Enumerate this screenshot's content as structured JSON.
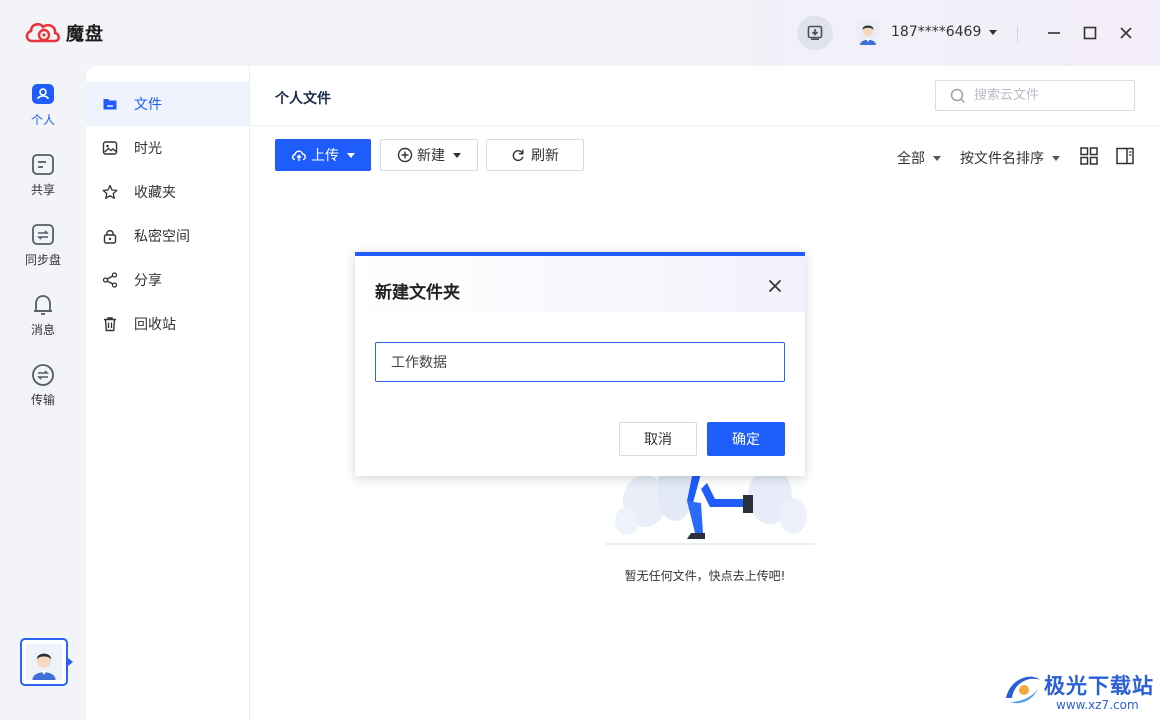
{
  "app": {
    "name": "魔盘"
  },
  "titlebar": {
    "user_phone": "187****6469"
  },
  "rail": {
    "items": [
      {
        "label": "个人",
        "icon": "personal-icon",
        "active": true
      },
      {
        "label": "共享",
        "icon": "share-folder-icon",
        "active": false
      },
      {
        "label": "同步盘",
        "icon": "sync-icon",
        "active": false
      },
      {
        "label": "消息",
        "icon": "bell-icon",
        "active": false
      },
      {
        "label": "传输",
        "icon": "transfer-icon",
        "active": false
      }
    ]
  },
  "sidebar": {
    "items": [
      {
        "label": "文件",
        "icon": "folder-icon",
        "active": true
      },
      {
        "label": "时光",
        "icon": "photo-icon",
        "active": false
      },
      {
        "label": "收藏夹",
        "icon": "star-icon",
        "active": false
      },
      {
        "label": "私密空间",
        "icon": "lock-icon",
        "active": false
      },
      {
        "label": "分享",
        "icon": "share-icon",
        "active": false
      },
      {
        "label": "回收站",
        "icon": "trash-icon",
        "active": false
      }
    ]
  },
  "main": {
    "title": "个人文件",
    "search_placeholder": "搜索云文件",
    "toolbar": {
      "upload": "上传",
      "new": "新建",
      "refresh": "刷新"
    },
    "filter": "全部",
    "sort": "按文件名排序",
    "empty_text": "暂无任何文件，快点去上传吧!"
  },
  "dialog": {
    "title": "新建文件夹",
    "input_value": "工作数据",
    "cancel": "取消",
    "ok": "确定"
  },
  "watermark": {
    "text": "极光下载站",
    "url": "www.xz7.com"
  },
  "colors": {
    "accent": "#1e5dfc",
    "logo_red": "#e8323c"
  }
}
